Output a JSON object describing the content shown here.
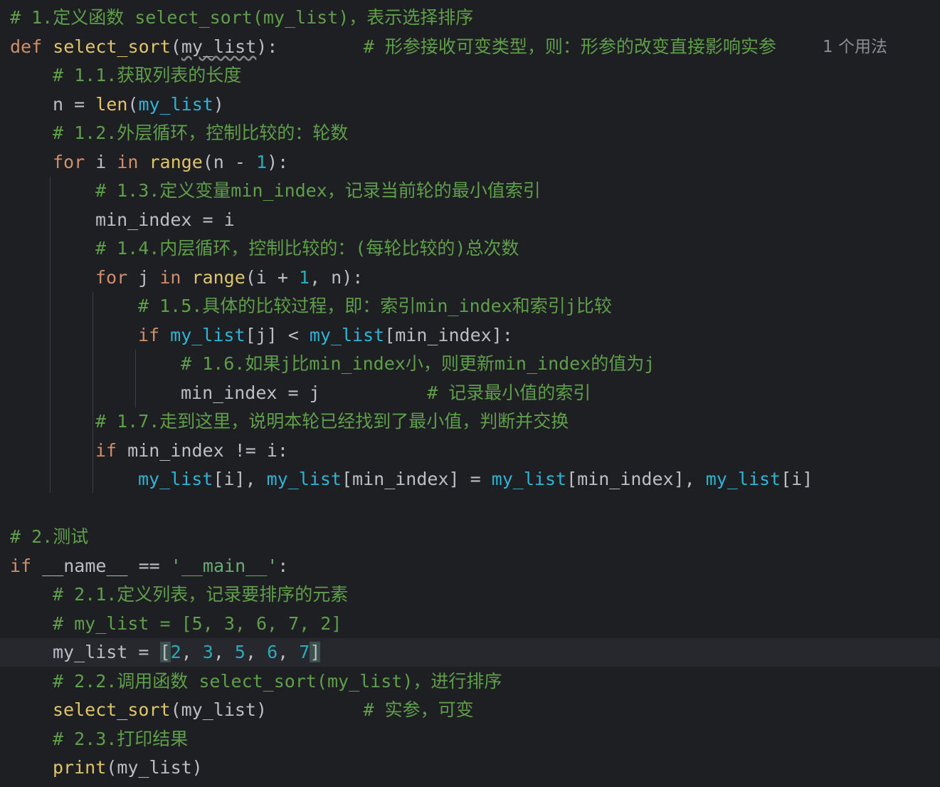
{
  "editor": {
    "usage_hint": "1 个用法",
    "lines": [
      {
        "segments": [
          {
            "t": "# 1.定义函数 select_sort(my_list)，表示选择排序",
            "c": "cm"
          }
        ]
      },
      {
        "segments": [
          {
            "t": "def ",
            "c": "kw"
          },
          {
            "t": "select_sort",
            "c": "bi"
          },
          {
            "t": "(",
            "c": "pl"
          },
          {
            "t": "my_list",
            "c": "pl un"
          },
          {
            "t": "):        ",
            "c": "pl"
          },
          {
            "t": "# 形参接收可变类型，则：形参的改变直接影响实参",
            "c": "cm"
          }
        ]
      },
      {
        "segments": [
          {
            "t": "# 1.1.获取列表的长度",
            "c": "cm"
          }
        ]
      },
      {
        "segments": [
          {
            "t": "n = ",
            "c": "pl"
          },
          {
            "t": "len",
            "c": "bi"
          },
          {
            "t": "(",
            "c": "pl"
          },
          {
            "t": "my_list",
            "c": "pm"
          },
          {
            "t": ")",
            "c": "pl"
          }
        ]
      },
      {
        "segments": [
          {
            "t": "# 1.2.外层循环，控制比较的：轮数",
            "c": "cm"
          }
        ]
      },
      {
        "segments": [
          {
            "t": "for ",
            "c": "kw"
          },
          {
            "t": "i ",
            "c": "pl"
          },
          {
            "t": "in ",
            "c": "kw"
          },
          {
            "t": "range",
            "c": "bi"
          },
          {
            "t": "(n - ",
            "c": "pl"
          },
          {
            "t": "1",
            "c": "nm"
          },
          {
            "t": "):",
            "c": "pl"
          }
        ]
      },
      {
        "segments": [
          {
            "t": "# 1.3.定义变量min_index，记录当前轮的最小值索引",
            "c": "cm"
          }
        ]
      },
      {
        "segments": [
          {
            "t": "min_index = i",
            "c": "pl"
          }
        ]
      },
      {
        "segments": [
          {
            "t": "# 1.4.内层循环，控制比较的：(每轮比较的)总次数",
            "c": "cm"
          }
        ]
      },
      {
        "segments": [
          {
            "t": "for ",
            "c": "kw"
          },
          {
            "t": "j ",
            "c": "pl"
          },
          {
            "t": "in ",
            "c": "kw"
          },
          {
            "t": "range",
            "c": "bi"
          },
          {
            "t": "(i + ",
            "c": "pl"
          },
          {
            "t": "1",
            "c": "nm"
          },
          {
            "t": ", n):",
            "c": "pl"
          }
        ]
      },
      {
        "segments": [
          {
            "t": "# 1.5.具体的比较过程，即：索引min_index和索引j比较",
            "c": "cm"
          }
        ]
      },
      {
        "segments": [
          {
            "t": "if ",
            "c": "kw"
          },
          {
            "t": "my_list",
            "c": "pm"
          },
          {
            "t": "[j] < ",
            "c": "pl"
          },
          {
            "t": "my_list",
            "c": "pm"
          },
          {
            "t": "[min_index]:",
            "c": "pl"
          }
        ]
      },
      {
        "segments": [
          {
            "t": "# 1.6.如果j比min_index小，则更新min_index的值为j",
            "c": "cm"
          }
        ]
      },
      {
        "segments": [
          {
            "t": "min_index = j          ",
            "c": "pl"
          },
          {
            "t": "# 记录最小值的索引",
            "c": "cm"
          }
        ]
      },
      {
        "segments": [
          {
            "t": "# 1.7.走到这里，说明本轮已经找到了最小值，判断并交换",
            "c": "cm"
          }
        ]
      },
      {
        "segments": [
          {
            "t": "if ",
            "c": "kw"
          },
          {
            "t": "min_index != i:",
            "c": "pl"
          }
        ]
      },
      {
        "segments": [
          {
            "t": "my_list",
            "c": "pm"
          },
          {
            "t": "[i], ",
            "c": "pl"
          },
          {
            "t": "my_list",
            "c": "pm"
          },
          {
            "t": "[min_index] = ",
            "c": "pl"
          },
          {
            "t": "my_list",
            "c": "pm"
          },
          {
            "t": "[min_index], ",
            "c": "pl"
          },
          {
            "t": "my_list",
            "c": "pm"
          },
          {
            "t": "[i]",
            "c": "pl"
          }
        ]
      },
      {
        "segments": []
      },
      {
        "segments": [
          {
            "t": "# 2.测试",
            "c": "cm"
          }
        ]
      },
      {
        "segments": [
          {
            "t": "if ",
            "c": "kw"
          },
          {
            "t": "__name__ == ",
            "c": "pl"
          },
          {
            "t": "'__main__'",
            "c": "st"
          },
          {
            "t": ":",
            "c": "pl"
          }
        ]
      },
      {
        "segments": [
          {
            "t": "# 2.1.定义列表，记录要排序的元素",
            "c": "cm"
          }
        ]
      },
      {
        "segments": [
          {
            "t": "# my_list = [5, 3, 6, 7, 2]",
            "c": "cm"
          }
        ]
      },
      {
        "segments": [
          {
            "t": "my_list = ",
            "c": "pl"
          },
          {
            "t": "[",
            "c": "pl bracket-hl"
          },
          {
            "t": "2",
            "c": "nm"
          },
          {
            "t": ", ",
            "c": "pl"
          },
          {
            "t": "3",
            "c": "nm"
          },
          {
            "t": ", ",
            "c": "pl"
          },
          {
            "t": "5",
            "c": "nm"
          },
          {
            "t": ", ",
            "c": "pl"
          },
          {
            "t": "6",
            "c": "nm"
          },
          {
            "t": ", ",
            "c": "pl"
          },
          {
            "t": "7",
            "c": "nm"
          },
          {
            "t": "]",
            "c": "pl bracket-hl"
          }
        ]
      },
      {
        "segments": [
          {
            "t": "# 2.2.调用函数 select_sort(my_list)，进行排序",
            "c": "cm"
          }
        ]
      },
      {
        "segments": [
          {
            "t": "select_sort",
            "c": "bi"
          },
          {
            "t": "(my_list)         ",
            "c": "pl"
          },
          {
            "t": "# 实参，可变",
            "c": "cm"
          }
        ]
      },
      {
        "segments": [
          {
            "t": "# 2.3.打印结果",
            "c": "cm"
          }
        ]
      },
      {
        "segments": [
          {
            "t": "print",
            "c": "bi"
          },
          {
            "t": "(my_list)",
            "c": "pl"
          }
        ]
      }
    ]
  }
}
